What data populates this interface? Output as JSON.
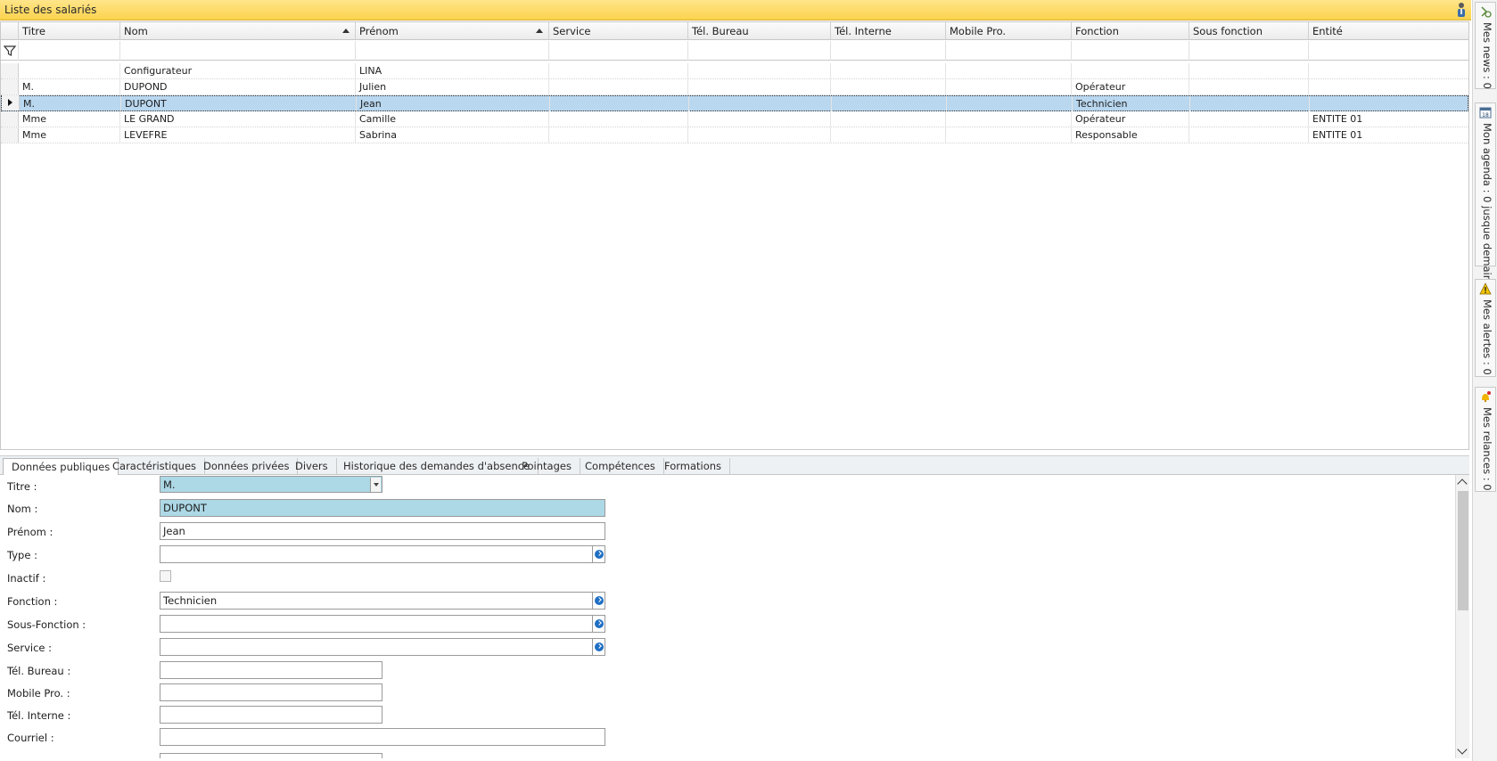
{
  "window": {
    "title": "Liste des salariés"
  },
  "grid": {
    "columns": [
      "Titre",
      "Nom",
      "Prénom",
      "Service",
      "Tél. Bureau",
      "Tél. Interne",
      "Mobile Pro.",
      "Fonction",
      "Sous fonction",
      "Entité"
    ],
    "rows": [
      {
        "titre": "",
        "nom": "Configurateur",
        "prenom": "LINA",
        "service": "",
        "tel_bureau": "",
        "tel_interne": "",
        "mobile": "",
        "fonction": "",
        "sous_fonction": "",
        "entite": ""
      },
      {
        "titre": "M.",
        "nom": "DUPOND",
        "prenom": "Julien",
        "service": "",
        "tel_bureau": "",
        "tel_interne": "",
        "mobile": "",
        "fonction": "Opérateur",
        "sous_fonction": "",
        "entite": ""
      },
      {
        "titre": "M.",
        "nom": "DUPONT",
        "prenom": "Jean",
        "service": "",
        "tel_bureau": "",
        "tel_interne": "",
        "mobile": "",
        "fonction": "Technicien",
        "sous_fonction": "",
        "entite": ""
      },
      {
        "titre": "Mme",
        "nom": "LE GRAND",
        "prenom": "Camille",
        "service": "",
        "tel_bureau": "",
        "tel_interne": "",
        "mobile": "",
        "fonction": "Opérateur",
        "sous_fonction": "",
        "entite": "ENTITE 01"
      },
      {
        "titre": "Mme",
        "nom": "LEVEFRE",
        "prenom": "Sabrina",
        "service": "",
        "tel_bureau": "",
        "tel_interne": "",
        "mobile": "",
        "fonction": "Responsable",
        "sous_fonction": "",
        "entite": "ENTITE 01"
      }
    ]
  },
  "tabs": [
    "Données publiques",
    "Caractéristiques",
    "Données privées",
    "Divers",
    "Historique des demandes d'absence",
    "Pointages",
    "Compétences",
    "Formations"
  ],
  "form": {
    "labels": {
      "titre": "Titre :",
      "nom": "Nom :",
      "prenom": "Prénom :",
      "type": "Type :",
      "inactif": "Inactif :",
      "fonction": "Fonction :",
      "sous_fonction": "Sous-Fonction :",
      "service": "Service :",
      "tel_bureau": "Tél. Bureau :",
      "mobile": "Mobile Pro. :",
      "tel_interne": "Tél. Interne :",
      "courriel": "Courriel :"
    },
    "values": {
      "titre": "M.",
      "nom": "DUPONT",
      "prenom": "Jean",
      "type": "",
      "fonction": "Technicien",
      "sous_fonction": "",
      "service": "",
      "tel_bureau": "",
      "mobile": "",
      "tel_interne": "",
      "courriel": ""
    }
  },
  "sidebar": {
    "news": "Mes news : 0",
    "agenda": "Mon agenda : 0 jusque demain",
    "agenda_day": "18",
    "alertes": "Mes alertes : 0",
    "relances": "Mes relances : 0"
  },
  "colors": {
    "title_bar": "#fcd34d",
    "selection": "#b9d7ef",
    "highlight_field": "#add8e6",
    "picker_blue": "#1f6fc3"
  }
}
